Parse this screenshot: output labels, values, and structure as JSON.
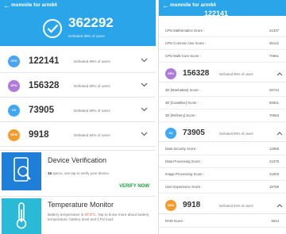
{
  "left": {
    "title": "msmnile for arm64",
    "back_glyph": "←",
    "total": {
      "score": "362292",
      "defeated": "Defeated 99% of users"
    },
    "rows": [
      {
        "badge": "CPU",
        "color": "#4aa5f0",
        "score": "122141",
        "defeated": "Defeated 99% of users"
      },
      {
        "badge": "GPU",
        "color": "#b07ad8",
        "score": "156328",
        "defeated": "Defeated 99% of users"
      },
      {
        "badge": "UX",
        "color": "#3fa8f4",
        "score": "73905",
        "defeated": "Defeated 99% of users"
      },
      {
        "badge": "MEM",
        "color": "#f39c2c",
        "score": "9918",
        "defeated": "Defeated 94% of users"
      }
    ],
    "verification": {
      "title": "Device Verification",
      "desc_count": "15",
      "desc_rest": " specs, one tap to verify your device.",
      "action": "VERIFY NOW"
    },
    "temperature": {
      "title": "Temperature Monitor",
      "desc_pre": "Battery temperature is ",
      "desc_temp": "37.0°C",
      "desc_post": ". Tap to know more about battery temperature, battery level and CPU load."
    }
  },
  "right": {
    "title": "msmnile for arm64",
    "back_glyph": "←",
    "peek_score": "122141",
    "cpu_items": [
      {
        "label": "CPU Mathematics Score :",
        "value": "21337"
      },
      {
        "label": "CPU Common Use Score :",
        "value": "35142"
      },
      {
        "label": "CPU Multi-Core Score :",
        "value": "70661"
      }
    ],
    "gpu": {
      "badge": "GPU",
      "color": "#b07ad8",
      "score": "156328",
      "defeated": "Defeated 99% of users"
    },
    "gpu_items": [
      {
        "label": "3D [Manhattan] Score :",
        "value": "28744"
      },
      {
        "label": "3D [Coastline] Score :",
        "value": "56921"
      },
      {
        "label": "3D [Refinery] Score :",
        "value": "70663"
      }
    ],
    "ux": {
      "badge": "UX",
      "color": "#3fa8f4",
      "score": "73905",
      "defeated": "Defeated 99% of users"
    },
    "ux_items": [
      {
        "label": "Data Security Score :",
        "value": "12968"
      },
      {
        "label": "Data Processing Score :",
        "value": "21075"
      },
      {
        "label": "Image Processing Score :",
        "value": "21903"
      },
      {
        "label": "User Experience Score :",
        "value": "18759"
      }
    ],
    "mem": {
      "badge": "MEM",
      "color": "#f39c2c",
      "score": "9918",
      "defeated": "Defeated 94% of users"
    },
    "mem_items": [
      {
        "label": "RAM Score :",
        "value": "5644"
      }
    ]
  },
  "colors": {
    "header_blue": "#2aa5ea",
    "verify_green": "#1e9e3a",
    "temp_red": "#e2492e"
  }
}
